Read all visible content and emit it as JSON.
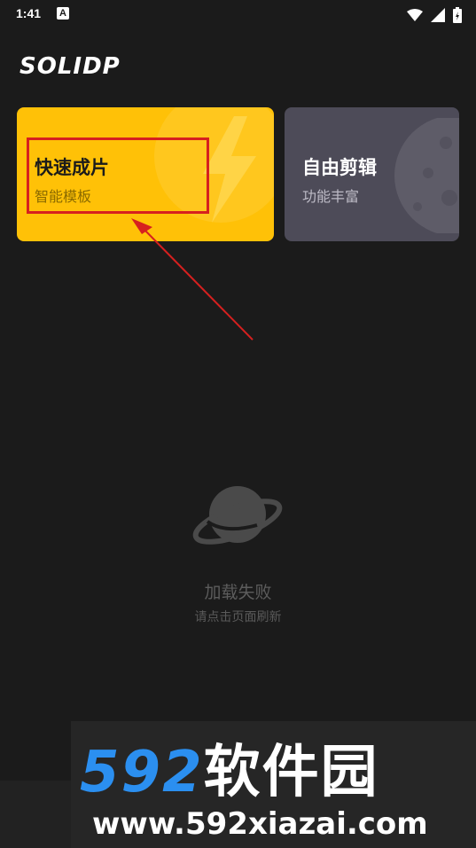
{
  "status_bar": {
    "time": "1:41",
    "badge": "A"
  },
  "app": {
    "logo": "SOLIDP"
  },
  "cards": {
    "quick": {
      "title": "快速成片",
      "subtitle": "智能模板",
      "color": "#ffc107"
    },
    "free": {
      "title": "自由剪辑",
      "subtitle": "功能丰富",
      "color": "#4d4b58"
    }
  },
  "error": {
    "title": "加载失败",
    "hint": "请点击页面刷新",
    "icon": "planet-icon"
  },
  "watermark": {
    "brand_num": "592",
    "brand_cn": "软件园",
    "url": "www.592xiazai.com"
  },
  "annotation": {
    "color": "#d6201f"
  }
}
